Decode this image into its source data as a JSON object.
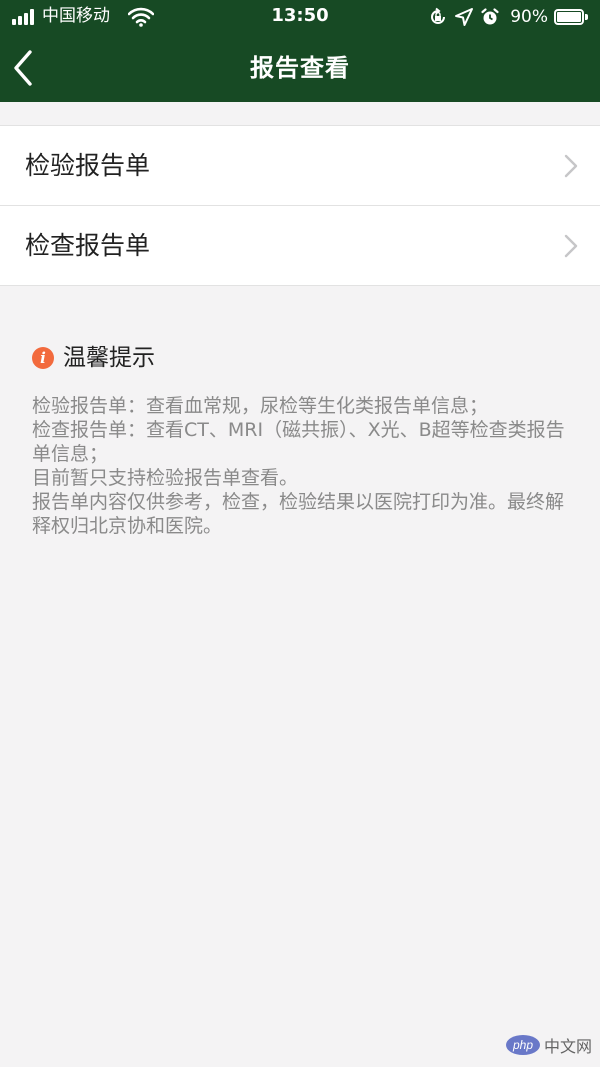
{
  "status_bar": {
    "carrier": "中国移动",
    "time": "13:50",
    "battery": "90%",
    "battery_level": 0.9
  },
  "nav": {
    "title": "报告查看"
  },
  "list": [
    {
      "label": "检验报告单"
    },
    {
      "label": "检查报告单"
    }
  ],
  "tips": {
    "title": "温馨提示",
    "lines": [
      "检验报告单：查看血常规，尿检等生化类报告单信息；",
      "检查报告单：查看CT、MRI（磁共振）、X光、B超等检查类报告单信息；",
      "目前暂只支持检验报告单查看。",
      "报告单内容仅供参考，检查，检验结果以医院打印为准。最终解释权归北京协和医院。"
    ]
  },
  "watermark": {
    "logo": "php",
    "text": "中文网"
  },
  "colors": {
    "header_bg": "#174a24",
    "page_bg": "#f4f3f4",
    "info_icon": "#f26a3d"
  }
}
